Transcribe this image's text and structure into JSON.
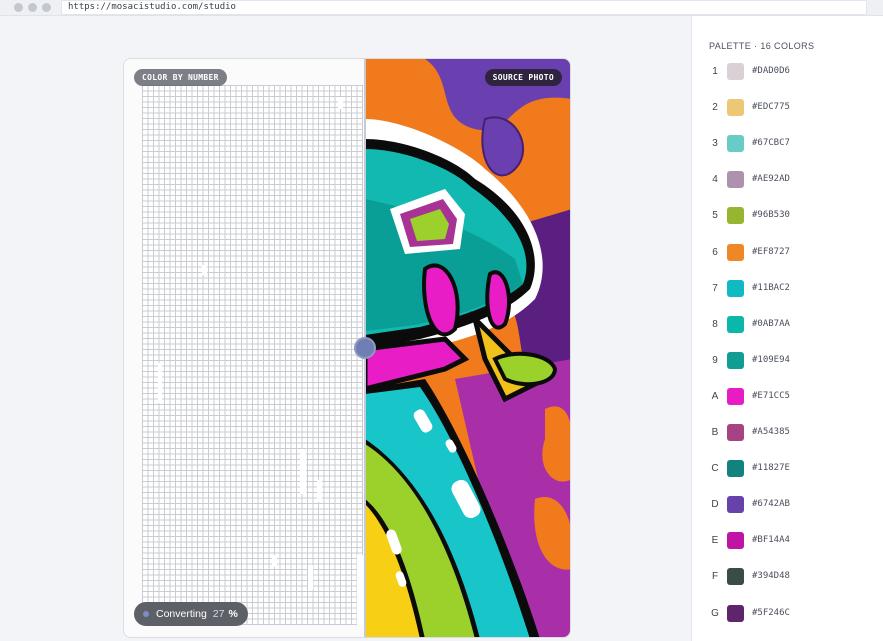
{
  "browser": {
    "url": "https://mosacistudio.com/studio"
  },
  "canvas": {
    "left_label": "COLOR BY NUMBER",
    "right_label": "SOURCE PHOTO",
    "status": {
      "label": "Converting",
      "percent": "27",
      "percent_sign": "%",
      "progress": 27
    }
  },
  "palette": {
    "title": "PALETTE · 16 COLORS",
    "colors": [
      {
        "key": "1",
        "hex": "#DAD0D6"
      },
      {
        "key": "2",
        "hex": "#EDC775"
      },
      {
        "key": "3",
        "hex": "#67CBC7"
      },
      {
        "key": "4",
        "hex": "#AE92AD"
      },
      {
        "key": "5",
        "hex": "#96B530"
      },
      {
        "key": "6",
        "hex": "#EF8727"
      },
      {
        "key": "7",
        "hex": "#11BAC2"
      },
      {
        "key": "8",
        "hex": "#0AB7AA"
      },
      {
        "key": "9",
        "hex": "#109E94"
      },
      {
        "key": "A",
        "hex": "#E71CC5"
      },
      {
        "key": "B",
        "hex": "#A54385"
      },
      {
        "key": "C",
        "hex": "#11827E"
      },
      {
        "key": "D",
        "hex": "#6742AB"
      },
      {
        "key": "E",
        "hex": "#BF14A4"
      },
      {
        "key": "F",
        "hex": "#394D48"
      },
      {
        "key": "G",
        "hex": "#5F246C"
      }
    ]
  }
}
